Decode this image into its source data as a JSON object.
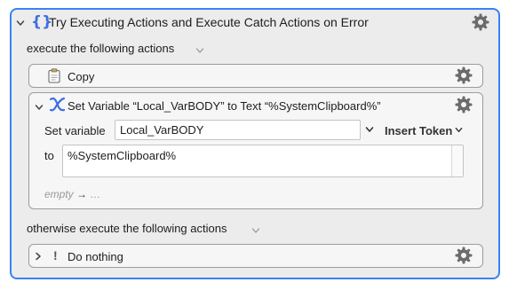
{
  "try_block": {
    "title": "Try Executing Actions and Execute Catch Actions on Error",
    "icon": "curly-braces-icon",
    "execute_label": "execute the following actions",
    "otherwise_label": "otherwise execute the following actions"
  },
  "copy_action": {
    "label": "Copy",
    "icon": "clipboard-icon"
  },
  "set_variable_action": {
    "title": "Set Variable “Local_VarBODY” to Text “%SystemClipboard%”",
    "icon": "variable-x-icon",
    "set_variable_label": "Set variable",
    "variable_name": "Local_VarBODY",
    "insert_token_label": "Insert Token",
    "to_label": "to",
    "text_value": "%SystemClipboard%",
    "empty_label": "empty",
    "empty_ellipsis": "…"
  },
  "do_nothing_action": {
    "label": "Do nothing",
    "icon": "exclamation-icon"
  },
  "colors": {
    "accent": "#3a82f6",
    "brace_blue": "#3f6fe0"
  }
}
